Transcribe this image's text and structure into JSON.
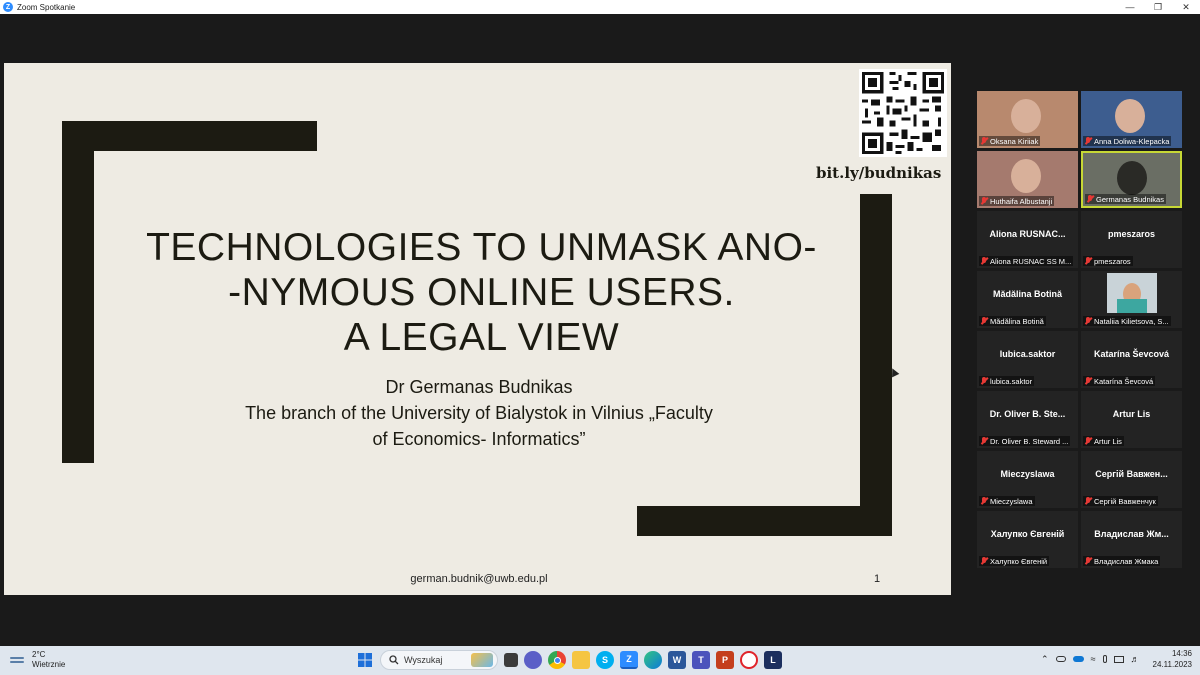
{
  "window": {
    "app_title": "Zoom Spotkanie",
    "minimize_icon": "minimize-icon",
    "restore_icon": "restore-icon",
    "close_icon": "close-icon"
  },
  "slide": {
    "title_line1": "TECHNOLOGIES TO UNMASK ANO-",
    "title_line2": "-NYMOUS ONLINE USERS.",
    "title_line3": "A LEGAL VIEW",
    "author": "Dr Germanas Budnikas",
    "affiliation_line1": "The branch of the University of Bialystok in Vilnius „Faculty",
    "affiliation_line2": "of Economics- Informatics”",
    "link": "bit.ly/budnikas",
    "email": "german.budnik@uwb.edu.pl",
    "page_number": "1",
    "accent_color": "#1c1b12",
    "background_color": "#eeebe3"
  },
  "participants": [
    {
      "tile_name": "",
      "label": "Oksana Kiriiak",
      "video": true
    },
    {
      "tile_name": "",
      "label": "Anna Doliwa-Klepacka",
      "video": true
    },
    {
      "tile_name": "",
      "label": "Huthaifa Albustanji",
      "video": true
    },
    {
      "tile_name": "",
      "label": "Germanas Budnikas",
      "video": true,
      "active_speaker": true
    },
    {
      "tile_name": "Aliona  RUSNAC...",
      "label": "Aliona RUSNAC SS M..."
    },
    {
      "tile_name": "pmeszaros",
      "label": "pmeszaros"
    },
    {
      "tile_name": "Mădălina Botină",
      "label": "Mădălina Botină"
    },
    {
      "tile_name": "",
      "label": "Nataliia Kilietsova, S...",
      "photo": true
    },
    {
      "tile_name": "lubica.saktor",
      "label": "lubica.saktor"
    },
    {
      "tile_name": "Katarína Ševcová",
      "label": "Katarína Ševcová"
    },
    {
      "tile_name": "Dr. Oliver B. Ste...",
      "label": "Dr. Oliver B. Steward ..."
    },
    {
      "tile_name": "Artur Lis",
      "label": "Artur Lis"
    },
    {
      "tile_name": "Mieczyslawa",
      "label": "Mieczyslawa"
    },
    {
      "tile_name": "Сергій Вавжен...",
      "label": "Сергій Вавженчук"
    },
    {
      "tile_name": "Халупко Євгеній",
      "label": "Халупко Євгеній"
    },
    {
      "tile_name": "Владислав  Жм...",
      "label": "Владислав Жмака"
    }
  ],
  "taskbar": {
    "temperature": "2°C",
    "weather": "Wietrznie",
    "search_placeholder": "Wyszukaj",
    "time": "14:36",
    "date": "24.11.2023"
  }
}
